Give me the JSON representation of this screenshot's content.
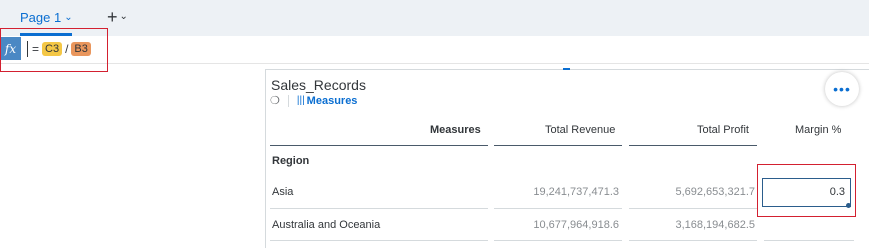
{
  "tabs": {
    "page_label": "Page 1",
    "add_label": "+"
  },
  "formula": {
    "fx_label": "fx",
    "equals": "=",
    "token1": "C3",
    "operator": "/",
    "token2": "B3"
  },
  "widget": {
    "title": "Sales_Records",
    "measures_label": "Measures",
    "more_label": "•••"
  },
  "table": {
    "headers": {
      "measures": "Measures",
      "total_revenue": "Total Revenue",
      "total_profit": "Total Profit",
      "margin": "Margin %"
    },
    "region_label": "Region",
    "rows": [
      {
        "name": "Asia",
        "revenue": "19,241,737,471.3",
        "profit": "5,692,653,321.7",
        "margin": "0.3"
      },
      {
        "name": "Australia and Oceania",
        "revenue": "10,677,964,918.6",
        "profit": "3,168,194,682.5",
        "margin": ""
      }
    ]
  },
  "colors": {
    "accent": "#0a6ed1",
    "highlight": "#d32030",
    "token_c3": "#f4c746",
    "token_b3": "#e9965d"
  }
}
